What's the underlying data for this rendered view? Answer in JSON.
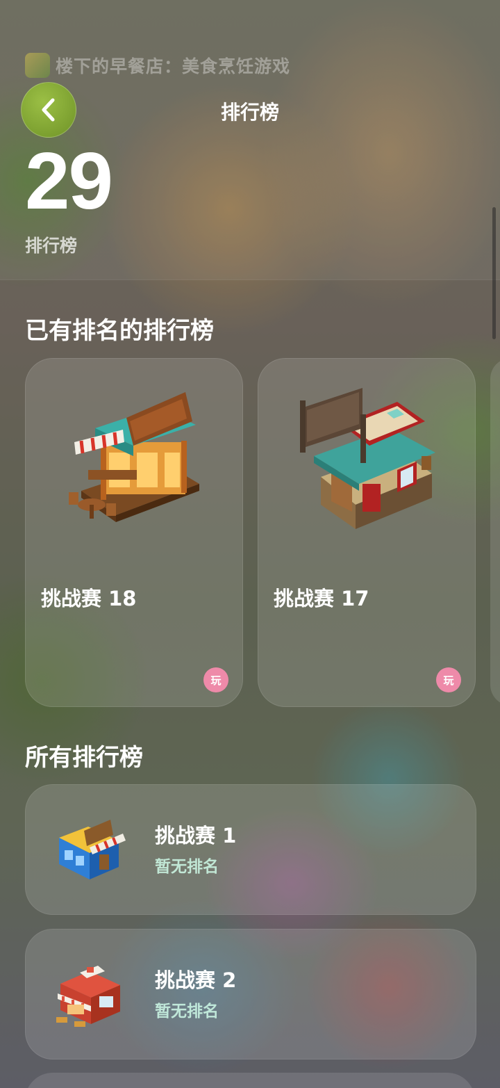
{
  "background": {
    "app_name": "楼下的早餐店：美食烹饪游戏"
  },
  "header": {
    "back_icon": "chevron-left-icon",
    "title": "排行榜",
    "count": "29",
    "count_caption": "排行榜"
  },
  "ranked_section": {
    "title": "已有排名的排行榜",
    "cards": [
      {
        "label": "挑战赛 18",
        "badge": "玩",
        "art": "wooden-food-stall-illustration"
      },
      {
        "label": "挑战赛 17",
        "badge": "玩",
        "art": "teal-roof-shop-illustration"
      }
    ]
  },
  "all_section": {
    "title": "所有排行榜",
    "rows": [
      {
        "title": "挑战赛 1",
        "status": "暂无排名",
        "art": "blue-shop-illustration"
      },
      {
        "title": "挑战赛 2",
        "status": "暂无排名",
        "art": "red-shop-illustration"
      }
    ]
  },
  "colors": {
    "back_button": "#7fa232",
    "play_badge": "#ee8aa9",
    "status_text": "#d2ffeb"
  }
}
